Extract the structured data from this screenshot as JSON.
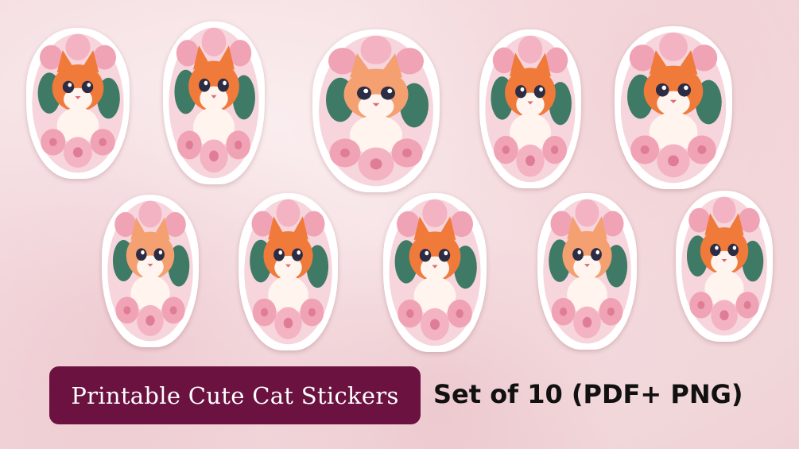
{
  "banner": {
    "title": "Printable Cute Cat Stickers",
    "subtitle": "Set of 10 (PDF+ PNG)"
  },
  "colors": {
    "title_bg": "#6b1240",
    "title_text": "#ffffff",
    "subtitle_text": "#111111",
    "flower_pink": "#f1a3b6",
    "cat_orange": "#f07a3a",
    "leaf_green": "#3e7a66"
  },
  "stickers": [
    {
      "name": "sticker-cat-1"
    },
    {
      "name": "sticker-cat-2"
    },
    {
      "name": "sticker-cat-3"
    },
    {
      "name": "sticker-cat-4"
    },
    {
      "name": "sticker-cat-5"
    },
    {
      "name": "sticker-cat-6"
    },
    {
      "name": "sticker-cat-7"
    },
    {
      "name": "sticker-cat-8"
    },
    {
      "name": "sticker-cat-9"
    },
    {
      "name": "sticker-cat-10"
    }
  ]
}
